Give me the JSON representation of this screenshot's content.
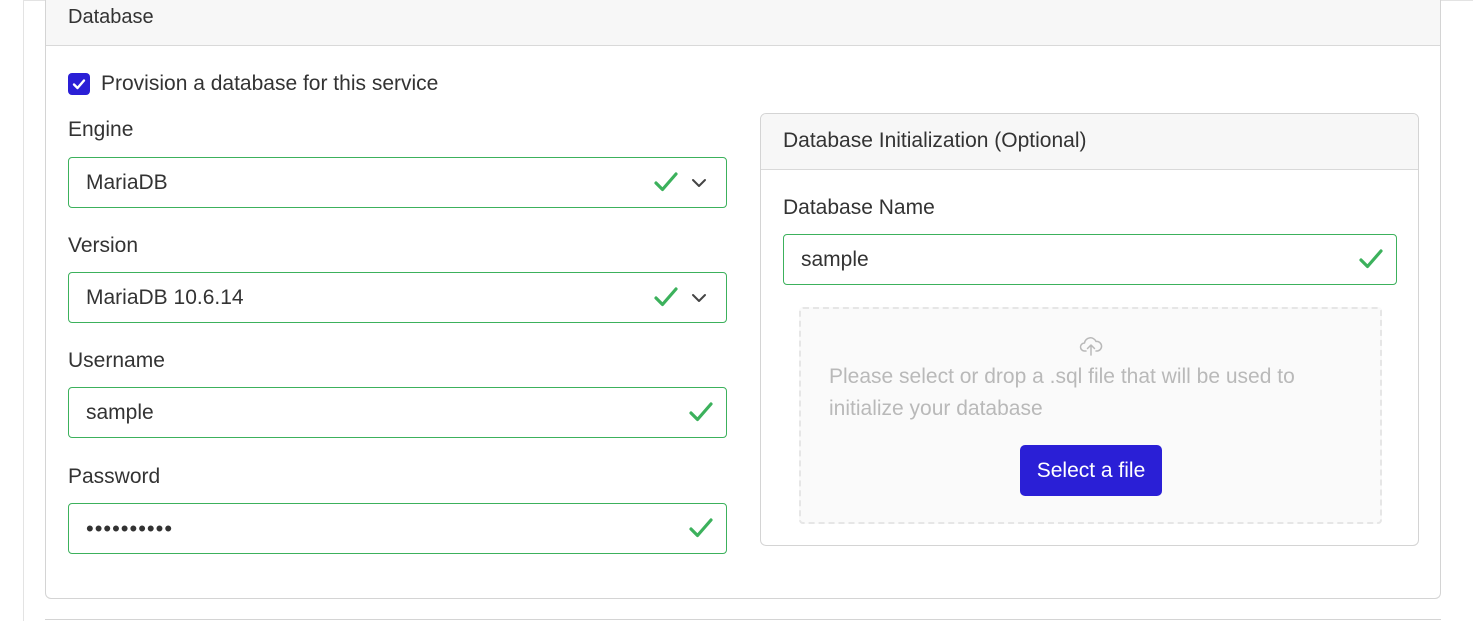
{
  "section": {
    "title": "Database"
  },
  "provision": {
    "label": "Provision a database for this service",
    "checked": true
  },
  "engine": {
    "label": "Engine",
    "value": "MariaDB"
  },
  "version": {
    "label": "Version",
    "value": "MariaDB 10.6.14"
  },
  "username": {
    "label": "Username",
    "value": "sample"
  },
  "password": {
    "label": "Password",
    "value": "••••••••••"
  },
  "init": {
    "title": "Database Initialization (Optional)",
    "db_name_label": "Database Name",
    "db_name_value": "sample",
    "drop_text": "Please select or drop a .sql file that will be used to initialize your database",
    "button_label": "Select a file"
  },
  "icons": {
    "check": "checkmark-icon",
    "valid": "valid-check-icon",
    "chevron": "chevron-down-icon",
    "upload": "cloud-upload-icon"
  },
  "colors": {
    "accent": "#2a1fd6",
    "valid": "#3cb15c",
    "header_bg": "#f7f7f7",
    "placeholder_text": "#b9b9b9"
  }
}
